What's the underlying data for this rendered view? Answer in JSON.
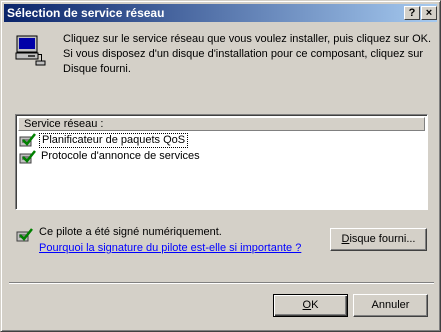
{
  "window": {
    "title": "Sélection de service réseau",
    "help_button": "?",
    "close_button": "×"
  },
  "intro": {
    "lines": [
      "Cliquez sur le service réseau que vous voulez installer, puis cliquez sur OK.",
      "Si vous disposez d'un disque d'installation pour ce composant, cliquez sur",
      "Disque fourni."
    ],
    "icon": "network-computer-icon"
  },
  "service_list": {
    "header": "Service réseau :",
    "items": [
      {
        "label": "Planificateur de paquets QoS",
        "selected": true,
        "icon": "network-service-icon"
      },
      {
        "label": "Protocole d'annonce de services",
        "selected": false,
        "icon": "network-service-icon"
      }
    ]
  },
  "signature": {
    "text": "Ce pilote a été signé numériquement.",
    "link": "Pourquoi la signature du pilote est-elle si importante ?",
    "icon": "signed-driver-icon"
  },
  "buttons": {
    "have_disk": {
      "prefix": "",
      "mnemonic": "D",
      "rest": "isque fourni..."
    },
    "ok": {
      "prefix": "",
      "mnemonic": "O",
      "rest": "K"
    },
    "cancel": "Annuler"
  },
  "colors": {
    "face": "#d4d0c8",
    "title_start": "#0a246a",
    "title_end": "#a6caf0",
    "link": "#0000ff"
  }
}
